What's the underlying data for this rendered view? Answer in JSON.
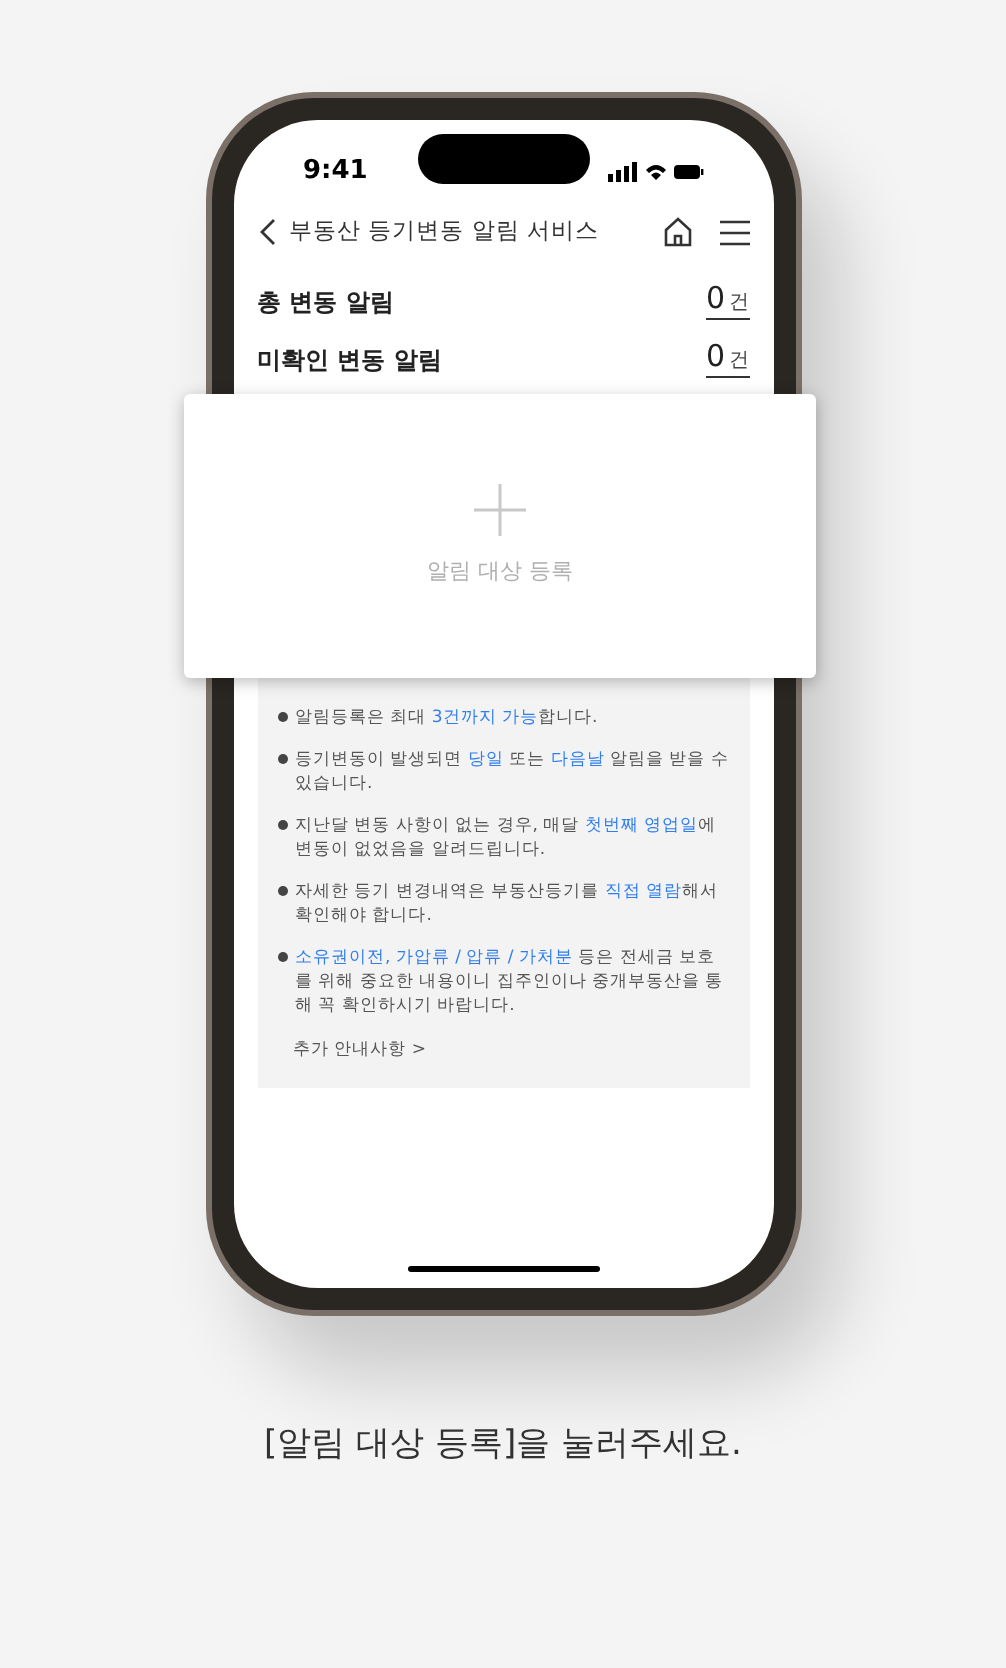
{
  "status_bar": {
    "time": "9:41"
  },
  "header": {
    "title": "부동산 등기변동 알림 서비스"
  },
  "stats": [
    {
      "label": "총 변동 알림",
      "count": "0",
      "unit": "건"
    },
    {
      "label": "미확인 변동 알림",
      "count": "0",
      "unit": "건"
    }
  ],
  "register_card": {
    "label": "알림 대상 등록"
  },
  "notes": [
    [
      {
        "text": "알림등록은 최대 ",
        "highlight": false
      },
      {
        "text": "3건까지 가능",
        "highlight": true
      },
      {
        "text": "합니다.",
        "highlight": false
      }
    ],
    [
      {
        "text": "등기변동이 발생되면 ",
        "highlight": false
      },
      {
        "text": "당일",
        "highlight": true
      },
      {
        "text": " 또는 ",
        "highlight": false
      },
      {
        "text": "다음날",
        "highlight": true
      },
      {
        "text": " 알림을 받을 수 있습니다.",
        "highlight": false
      }
    ],
    [
      {
        "text": "지난달 변동 사항이 없는 경우, 매달 ",
        "highlight": false
      },
      {
        "text": "첫번째 영업일",
        "highlight": true
      },
      {
        "text": "에 변동이 없었음을 알려드립니다.",
        "highlight": false
      }
    ],
    [
      {
        "text": "자세한 등기 변경내역은 부동산등기를 ",
        "highlight": false
      },
      {
        "text": "직접 열람",
        "highlight": true
      },
      {
        "text": "해서 확인해야 합니다.",
        "highlight": false
      }
    ],
    [
      {
        "text": "소유권이전, 가압류 / 압류 / 가처분",
        "highlight": true
      },
      {
        "text": " 등은 전세금 보호를 위해 중요한 내용이니 집주인이나 중개부동산을 통해 꼭 확인하시기 바랍니다.",
        "highlight": false
      }
    ]
  ],
  "more_link": "추가 안내사항 >",
  "caption": "[알림 대상 등록]을 눌러주세요."
}
